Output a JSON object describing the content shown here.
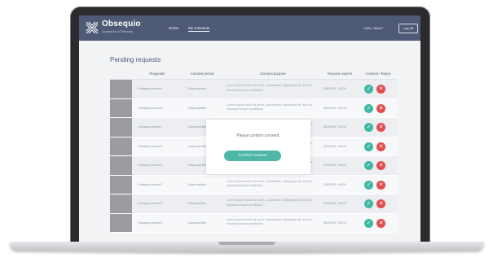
{
  "app": {
    "brand": "Obsequio",
    "tagline": "Consent for IoT Security",
    "logo_icon": "x-cross-logo-icon"
  },
  "nav": {
    "home": "Home",
    "my_consents": "My Consents",
    "hello": "Hello \"Name\"",
    "logout": "Log off"
  },
  "page": {
    "title": "Pending requests"
  },
  "table": {
    "headers": [
      "Requester",
      "Consent period",
      "Consent purpose",
      "Request expires",
      "Consent / Reject"
    ],
    "rows": [
      {
        "company": "Company name A",
        "period": "Days/months",
        "purpose": "Lorem ipsum dolor sit amet, consectetur adipiscing elit, sed do eiusmod tempor incididunt.",
        "expires": "00/00/00 · 00:00"
      },
      {
        "company": "Company name B",
        "period": "Days/months",
        "purpose": "Lorem ipsum dolor sit amet, consectetur adipiscing elit, sed do eiusmod tempor incididunt.",
        "expires": "00/00/00 · 00:00"
      },
      {
        "company": "Company name C",
        "period": "Days/months",
        "purpose": "Lorem ipsum dolor sit amet, consectetur adipiscing elit, sed do eiusmod tempor incididunt.",
        "expires": "00/00/00 · 00:00"
      },
      {
        "company": "Company name D",
        "period": "Days/months",
        "purpose": "Lorem ipsum dolor sit amet, consectetur adipiscing elit, sed do eiusmod tempor incididunt.",
        "expires": "00/00/00 · 00:00"
      },
      {
        "company": "Company name E",
        "period": "Days/months",
        "purpose": "Lorem ipsum dolor sit amet, consectetur adipiscing elit, sed do eiusmod tempor incididunt.",
        "expires": "00/00/00 · 00:00"
      },
      {
        "company": "Company name F",
        "period": "Days/months",
        "purpose": "Lorem ipsum dolor sit amet, consectetur adipiscing elit, sed do eiusmod tempor incididunt.",
        "expires": "00/00/00 · 00:00"
      },
      {
        "company": "Company name G",
        "period": "Days/months",
        "purpose": "Lorem ipsum dolor sit amet, consectetur adipiscing elit, sed do eiusmod tempor incididunt.",
        "expires": "00/00/00 · 00:00"
      },
      {
        "company": "Company name H",
        "period": "Days/months",
        "purpose": "Lorem ipsum dolor sit amet, consectetur adipiscing elit, sed do eiusmod tempor incididunt.",
        "expires": "00/00/00 · 00:00"
      }
    ],
    "accept_icon": "check-icon",
    "reject_icon": "close-icon"
  },
  "modal": {
    "message": "Please confirm consent.",
    "button": "Confirm consent"
  },
  "colors": {
    "header": "#4f5b76",
    "accept": "#3fb8a4",
    "reject": "#e14c4c",
    "modal_button": "#4fb7a6"
  }
}
